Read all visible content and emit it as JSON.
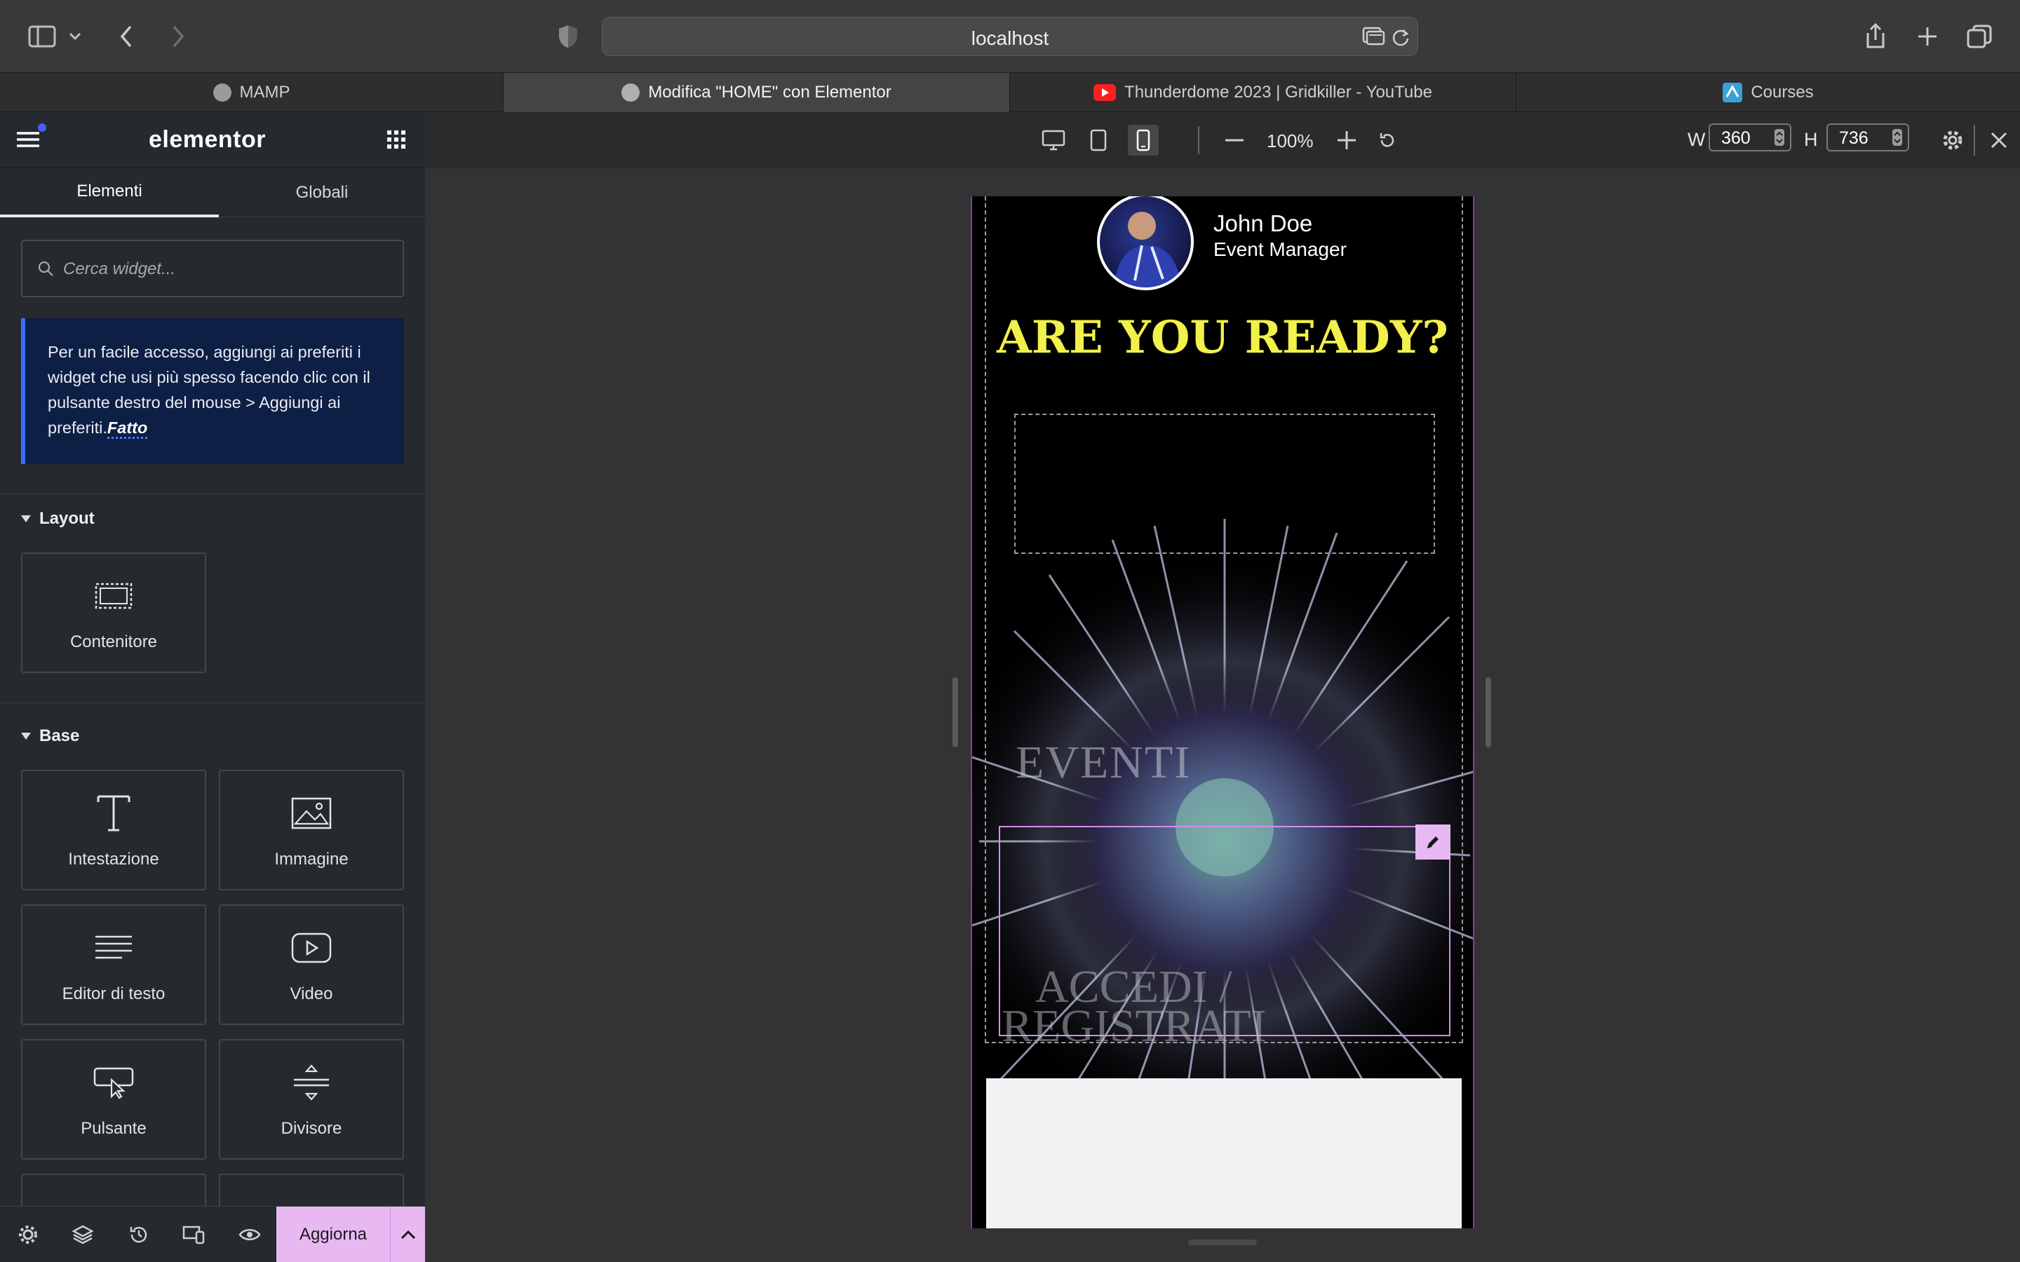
{
  "browser": {
    "url": "localhost",
    "tabs": [
      {
        "label": "MAMP",
        "active": false
      },
      {
        "label": "Modifica \"HOME\" con Elementor",
        "active": true
      },
      {
        "label": "Thunderdome 2023 | Gridkiller - YouTube",
        "active": false
      },
      {
        "label": "Courses",
        "active": false
      }
    ]
  },
  "panel": {
    "logo": "elementor",
    "tabs": [
      "Elementi",
      "Globali"
    ],
    "search_placeholder": "Cerca widget...",
    "tip_text": "Per un facile accesso, aggiungi ai preferiti i widget che usi più spesso facendo clic con il pulsante destro del mouse > Aggiungi ai preferiti.",
    "tip_done": "Fatto",
    "sections": {
      "layout": "Layout",
      "base": "Base"
    },
    "layout_widgets": [
      "Contenitore"
    ],
    "base_widgets": [
      "Intestazione",
      "Immagine",
      "Editor di testo",
      "Video",
      "Pulsante",
      "Divisore"
    ],
    "publish_label": "Aggiorna"
  },
  "responsive": {
    "zoom": "100%",
    "width_label": "W",
    "width": "360",
    "height_label": "H",
    "height": "736"
  },
  "preview": {
    "name": "John Doe",
    "role": "Event Manager",
    "headline": "ARE YOU READY?",
    "eventi": "EVENTI",
    "login_line1": "ACCEDI /",
    "login_line2": "REGISTRATI"
  },
  "colors": {
    "accent_pink": "#e8b8f3",
    "headline_yellow": "#f2f04a",
    "tip_bg": "#0e1f45",
    "panel_bg": "#26292d"
  }
}
